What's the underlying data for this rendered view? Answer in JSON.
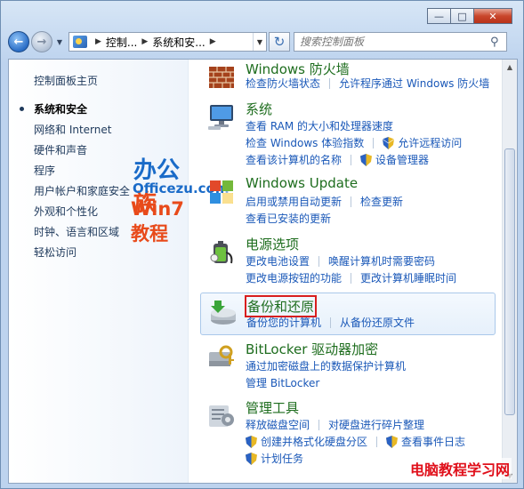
{
  "address_bar": {
    "crumbs": [
      "控制...",
      "系统和安..."
    ]
  },
  "search": {
    "placeholder": "搜索控制面板"
  },
  "sidebar": {
    "home": "控制面板主页",
    "items": [
      {
        "label": "系统和安全",
        "active": true
      },
      {
        "label": "网络和 Internet"
      },
      {
        "label": "硬件和声音"
      },
      {
        "label": "程序"
      },
      {
        "label": "用户帐户和家庭安全"
      },
      {
        "label": "外观和个性化"
      },
      {
        "label": "时钟、语言和区域"
      },
      {
        "label": "轻松访问"
      }
    ]
  },
  "watermark": {
    "line1_a": "办公",
    "line1_b": "族",
    "line2": "Officezu.com",
    "line3": "Win7教程"
  },
  "categories": {
    "firewall": {
      "title": "Windows 防火墙",
      "links": [
        "检查防火墙状态",
        "允许程序通过 Windows 防火墙"
      ]
    },
    "system": {
      "title": "系统",
      "links": [
        "查看 RAM 的大小和处理器速度",
        "检查 Windows 体验指数",
        "允许远程访问",
        "查看该计算机的名称",
        "设备管理器"
      ]
    },
    "update": {
      "title": "Windows Update",
      "links": [
        "启用或禁用自动更新",
        "检查更新",
        "查看已安装的更新"
      ]
    },
    "power": {
      "title": "电源选项",
      "links": [
        "更改电池设置",
        "唤醒计算机时需要密码",
        "更改电源按钮的功能",
        "更改计算机睡眠时间"
      ]
    },
    "backup": {
      "title": "备份和还原",
      "links": [
        "备份您的计算机",
        "从备份还原文件"
      ]
    },
    "bitlocker": {
      "title": "BitLocker 驱动器加密",
      "links": [
        "通过加密磁盘上的数据保护计算机",
        "管理 BitLocker"
      ]
    },
    "admin": {
      "title": "管理工具",
      "links": [
        "释放磁盘空间",
        "对硬盘进行碎片整理",
        "创建并格式化硬盘分区",
        "查看事件日志",
        "计划任务"
      ]
    }
  },
  "corner_watermark": "电脑教程学习网",
  "colors": {
    "link": "#1a58b8",
    "category_title": "#1e6d1e",
    "highlight_box": "#d81e1e"
  }
}
